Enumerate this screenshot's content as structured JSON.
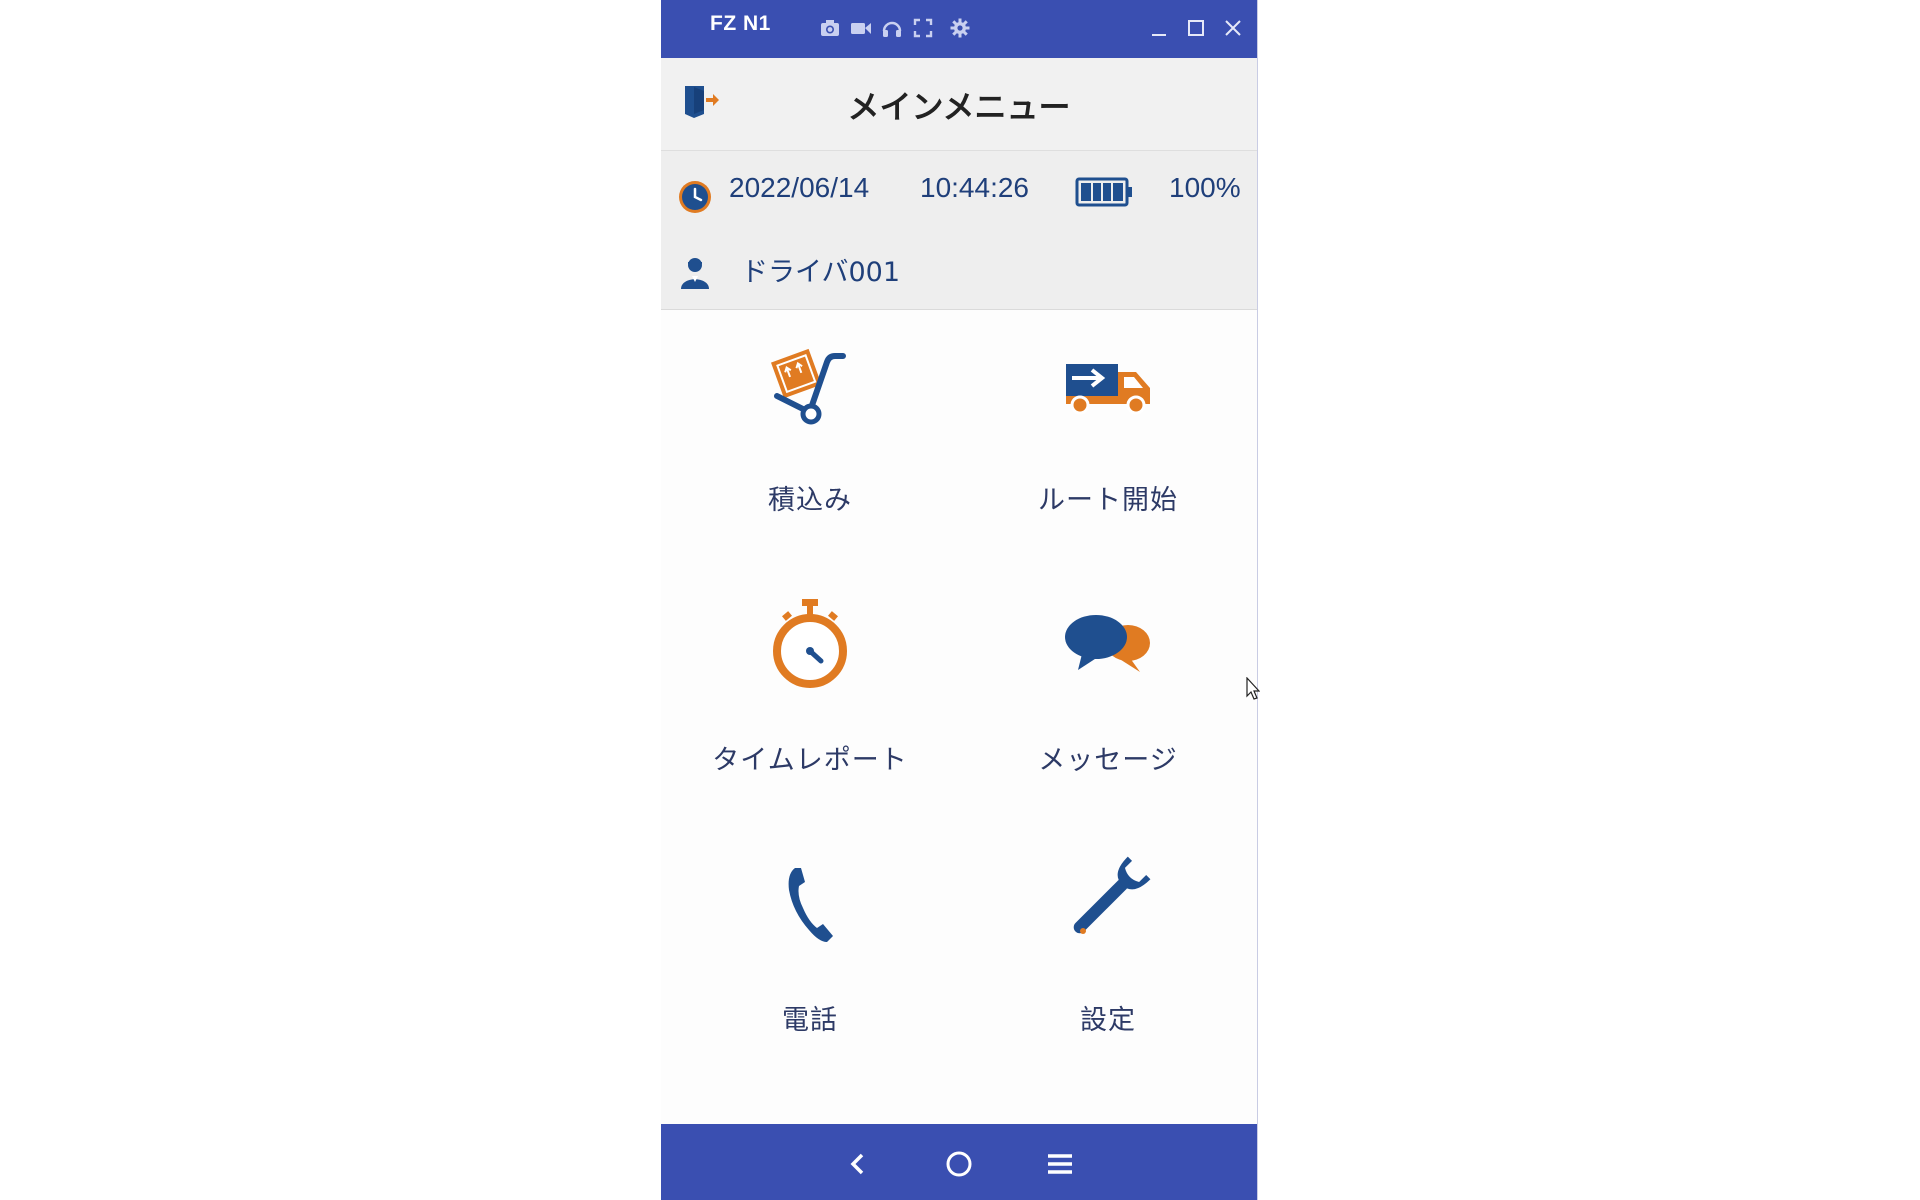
{
  "window": {
    "title": "FZ N1",
    "toolbar_icons": [
      "camera-icon",
      "video-icon",
      "headset-icon",
      "fullscreen-icon",
      "gear-icon"
    ],
    "controls": [
      "minimize-icon",
      "maximize-icon",
      "close-icon"
    ]
  },
  "header": {
    "title": "メインメニュー",
    "left_icon": "logout-icon"
  },
  "info": {
    "date": "2022/06/14",
    "time": "10:44:26",
    "battery_percent": "100%",
    "battery_level": 1.0,
    "driver": "ドライバ001"
  },
  "menu": [
    {
      "label": "積込み",
      "icon": "hand-truck-icon"
    },
    {
      "label": "ルート開始",
      "icon": "delivery-truck-icon"
    },
    {
      "label": "タイムレポート",
      "icon": "stopwatch-icon"
    },
    {
      "label": "メッセージ",
      "icon": "chat-bubbles-icon"
    },
    {
      "label": "電話",
      "icon": "phone-icon"
    },
    {
      "label": "設定",
      "icon": "wrench-icon"
    }
  ],
  "navbar": {
    "buttons": [
      "back-icon",
      "home-icon",
      "menu-icon"
    ]
  },
  "colors": {
    "primary_blue": "#3a4fb1",
    "icon_navy": "#1f4f8f",
    "icon_orange": "#e07b22",
    "text_blue": "#1f3f7a"
  }
}
